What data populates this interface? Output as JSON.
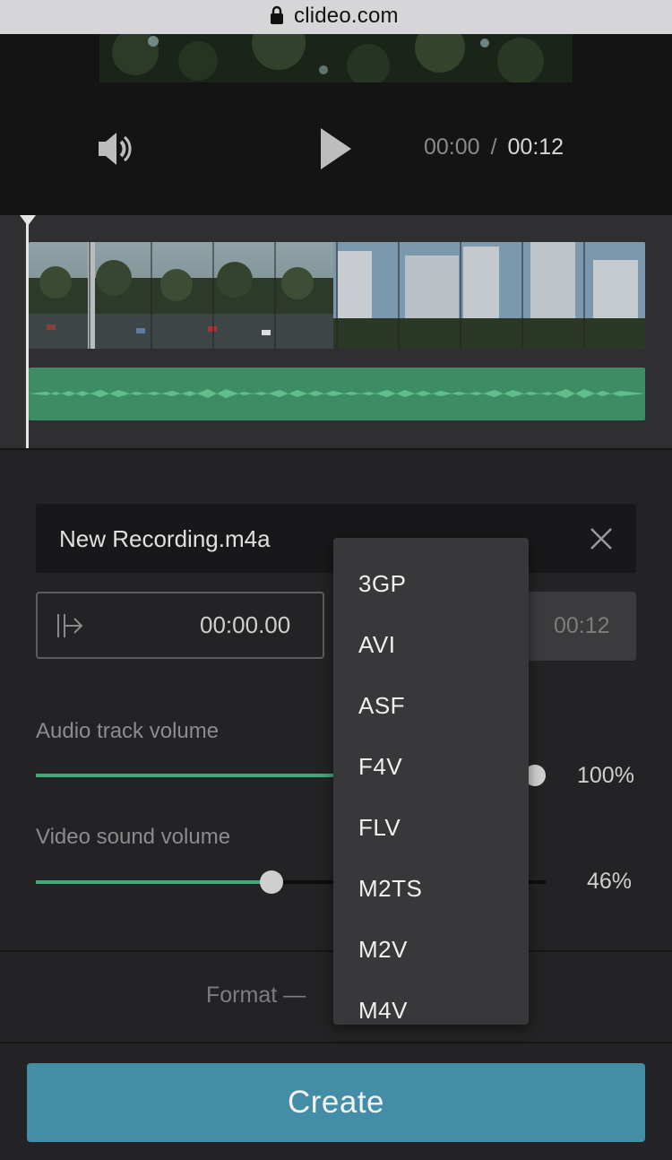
{
  "browser": {
    "url": "clideo.com"
  },
  "player": {
    "current_time": "00:00",
    "separator": "/",
    "duration": "00:12"
  },
  "file": {
    "name": "New Recording.m4a"
  },
  "trim": {
    "start": "00:00.00",
    "end": "00:12"
  },
  "audio_volume": {
    "label": "Audio track volume",
    "value": "100%",
    "level": 1.0
  },
  "video_volume": {
    "label": "Video sound volume",
    "value": "46%",
    "level": 0.46
  },
  "format": {
    "label": "Format —"
  },
  "dropdown": {
    "options": [
      "3GP",
      "AVI",
      "ASF",
      "F4V",
      "FLV",
      "M2TS",
      "M2V",
      "M4V"
    ]
  },
  "actions": {
    "create": "Create"
  },
  "colors": {
    "accent": "#3daa79",
    "create_button": "#438da6",
    "waveform": "#3e8c64"
  }
}
